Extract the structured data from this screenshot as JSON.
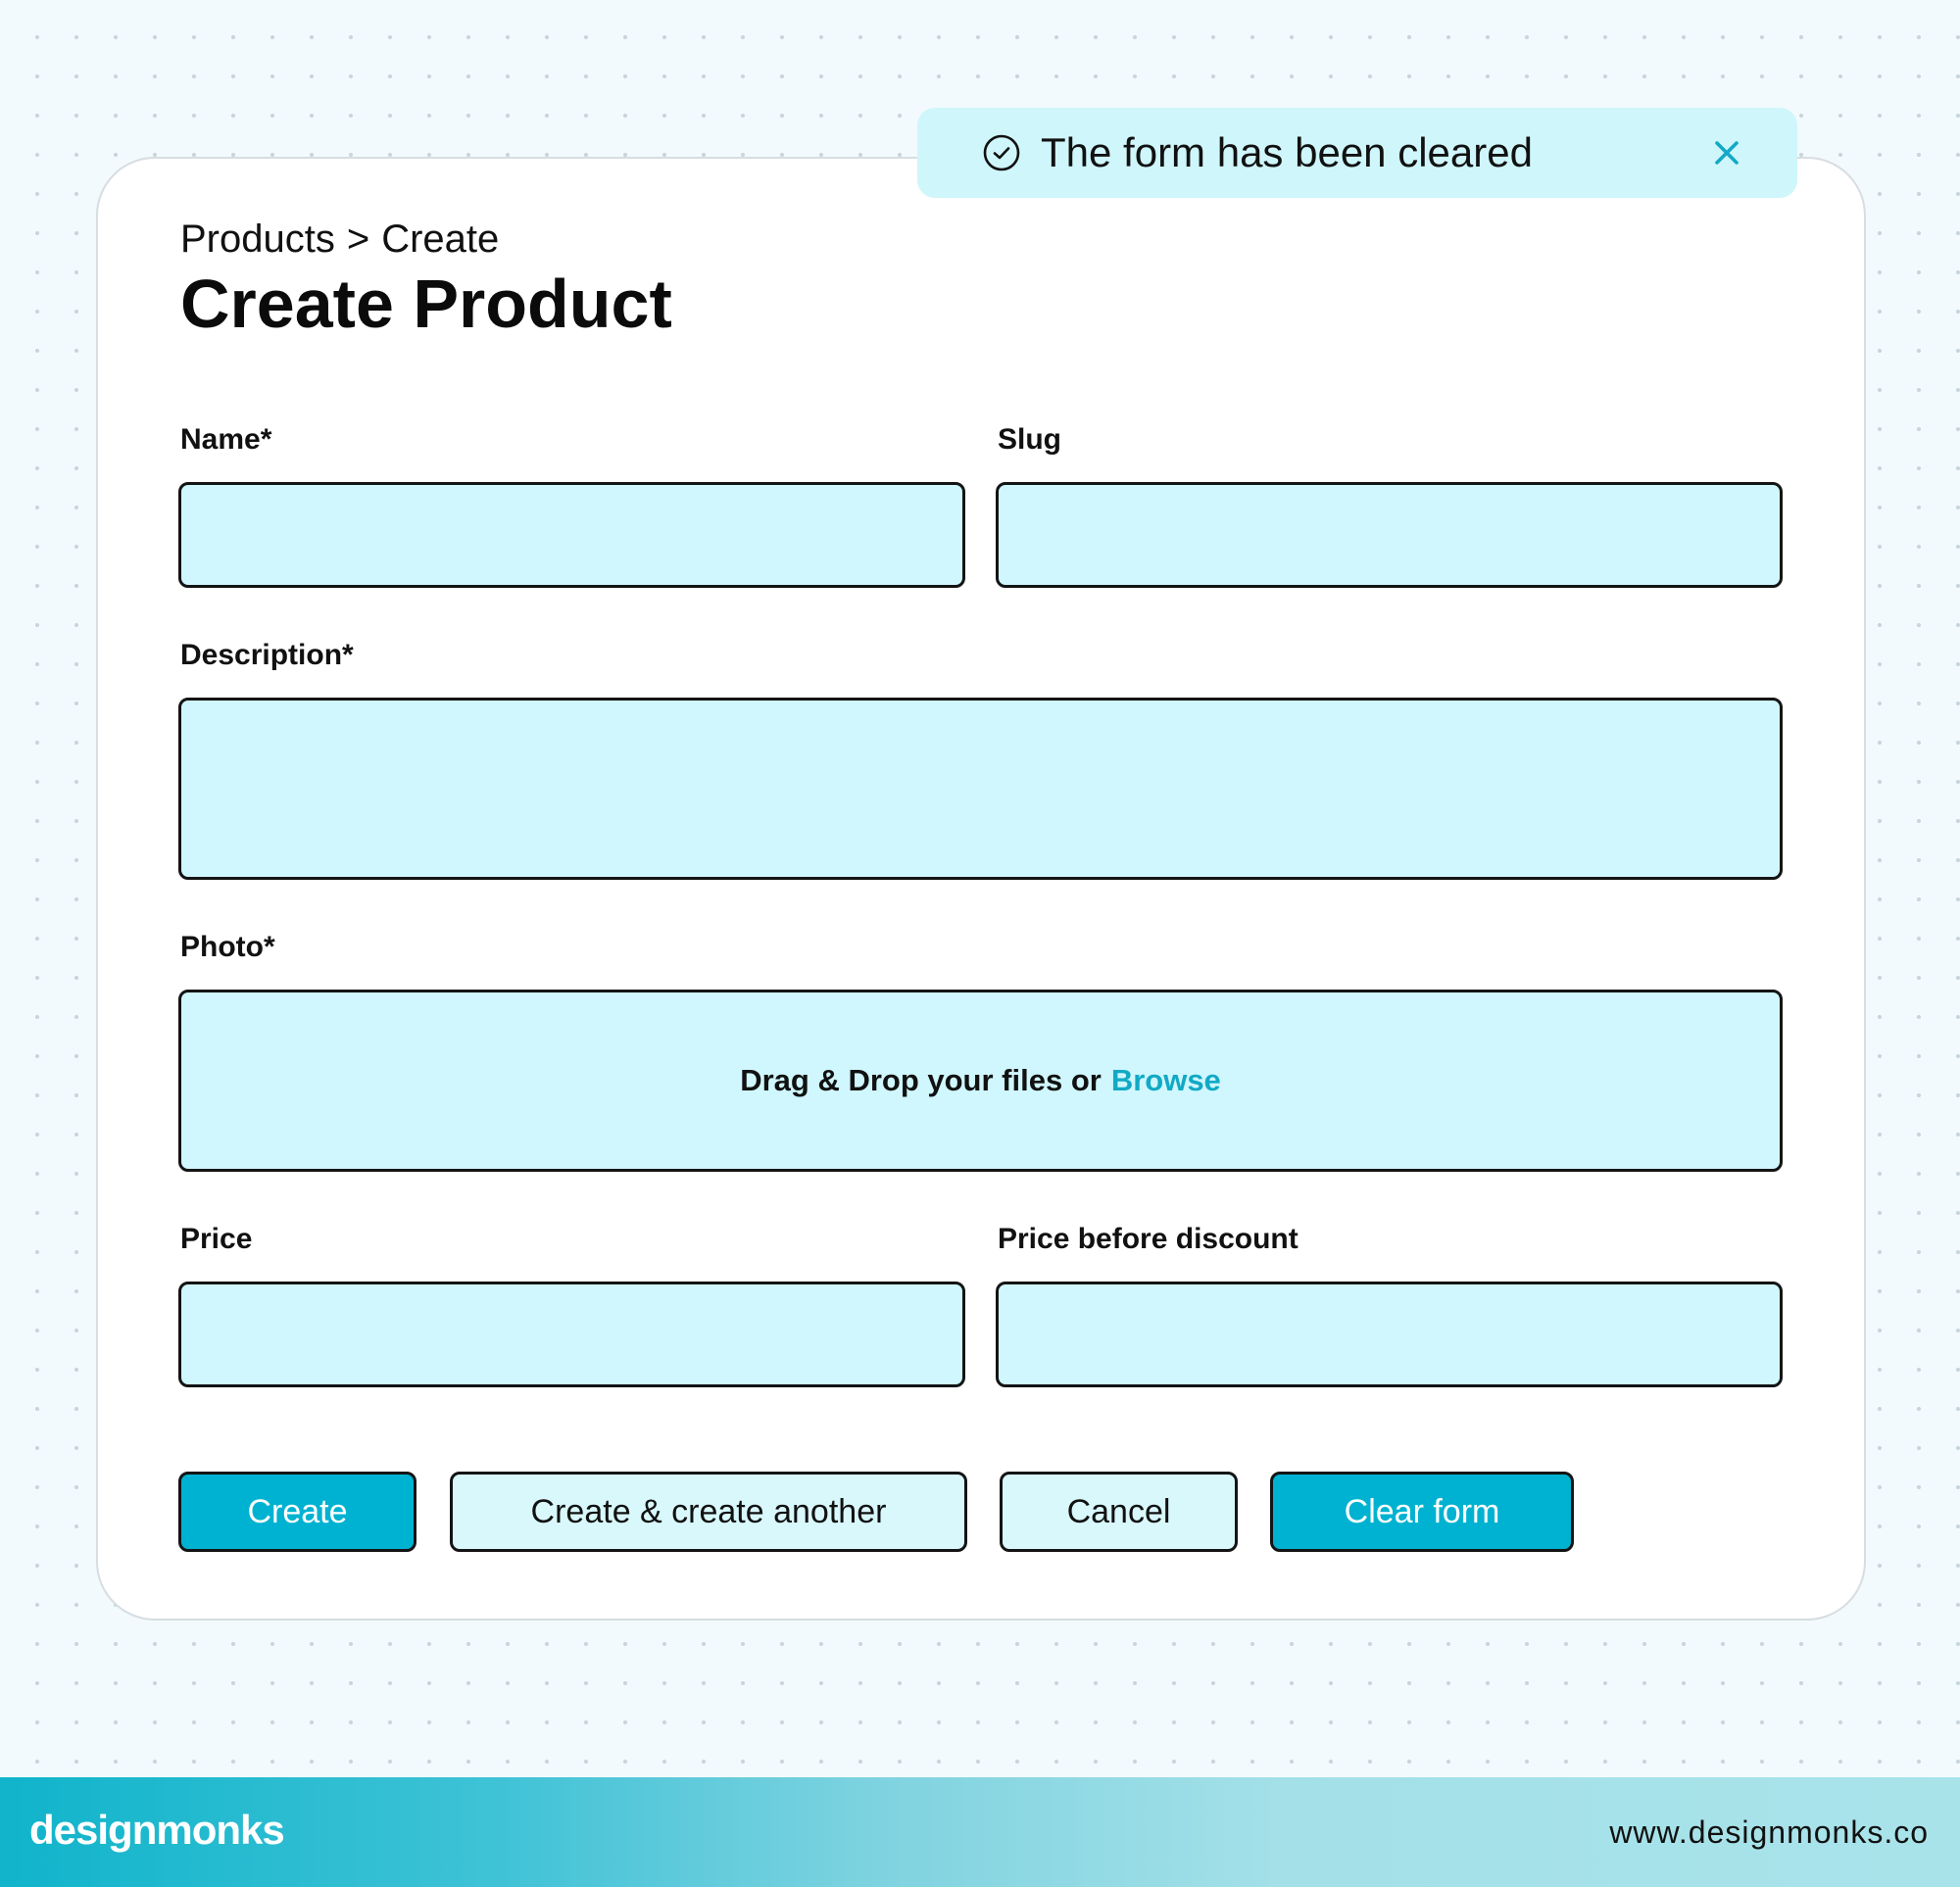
{
  "toast": {
    "message": "The form has been cleared",
    "icon": "check-circle-icon",
    "close_icon": "close-icon",
    "accent_color": "#12a9c6"
  },
  "breadcrumb": {
    "parent": "Products",
    "separator": ">",
    "current": "Create"
  },
  "page_title": "Create Product",
  "form": {
    "name": {
      "label": "Name*",
      "value": ""
    },
    "slug": {
      "label": "Slug",
      "value": ""
    },
    "description": {
      "label": "Description*",
      "value": ""
    },
    "photo": {
      "label": "Photo*",
      "drop_text": "Drag & Drop your files or",
      "browse_label": "Browse"
    },
    "price": {
      "label": "Price",
      "value": ""
    },
    "price_before_discount": {
      "label": "Price before discount",
      "value": ""
    }
  },
  "actions": {
    "create": "Create",
    "create_another": "Create & create another",
    "cancel": "Cancel",
    "clear": "Clear form"
  },
  "colors": {
    "primary": "#00b2d1",
    "field_bg": "#cff7fd",
    "toast_bg": "#cff6fb"
  },
  "footer": {
    "brand": "designmonks",
    "url": "www.designmonks.co"
  }
}
